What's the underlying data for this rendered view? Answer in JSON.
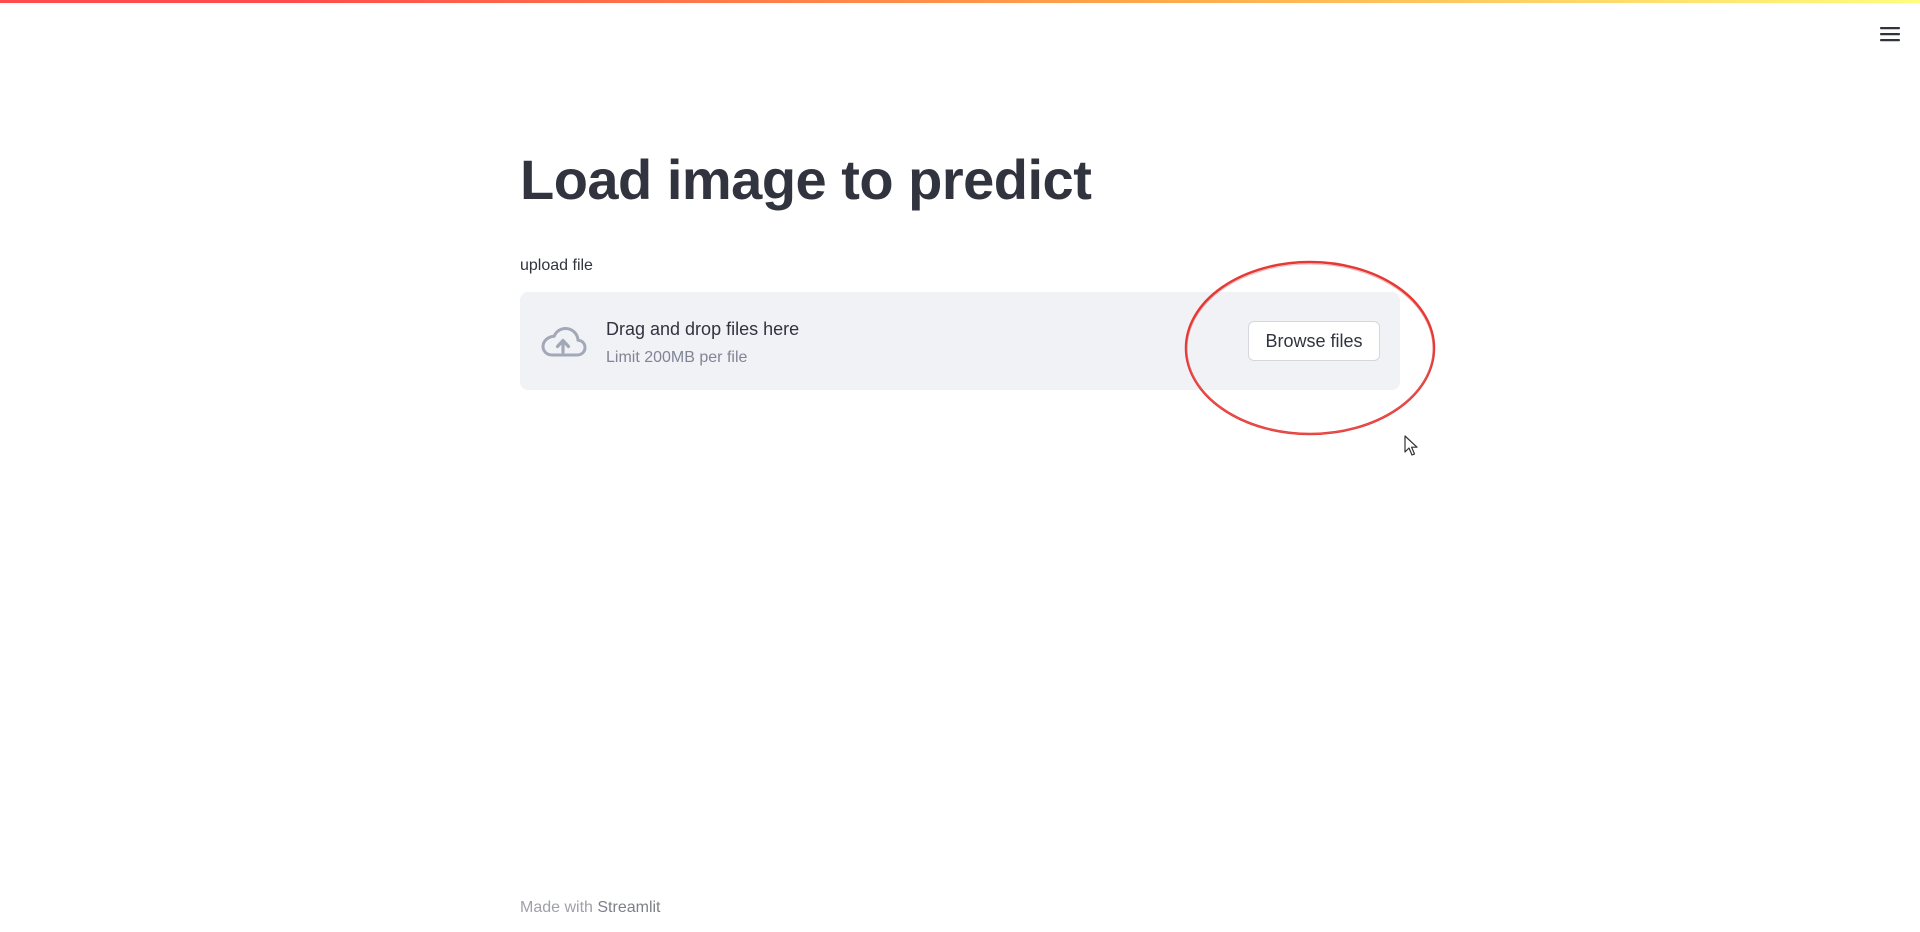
{
  "header": {
    "menu_icon": "hamburger-menu-icon",
    "decoration_colors": [
      "#ff4b4b",
      "#fda84a",
      "#fffd80"
    ]
  },
  "main": {
    "title": "Load image to predict",
    "uploader": {
      "label": "upload file",
      "icon": "cloud-upload-icon",
      "drop_text": "Drag and drop files here",
      "limit_text": "Limit 200MB per file",
      "browse_label": "Browse files"
    }
  },
  "annotation": {
    "shape": "ellipse",
    "color": "#e53935",
    "target": "browse-files-button"
  },
  "footer": {
    "prefix": "Made with",
    "link_text": "Streamlit"
  }
}
